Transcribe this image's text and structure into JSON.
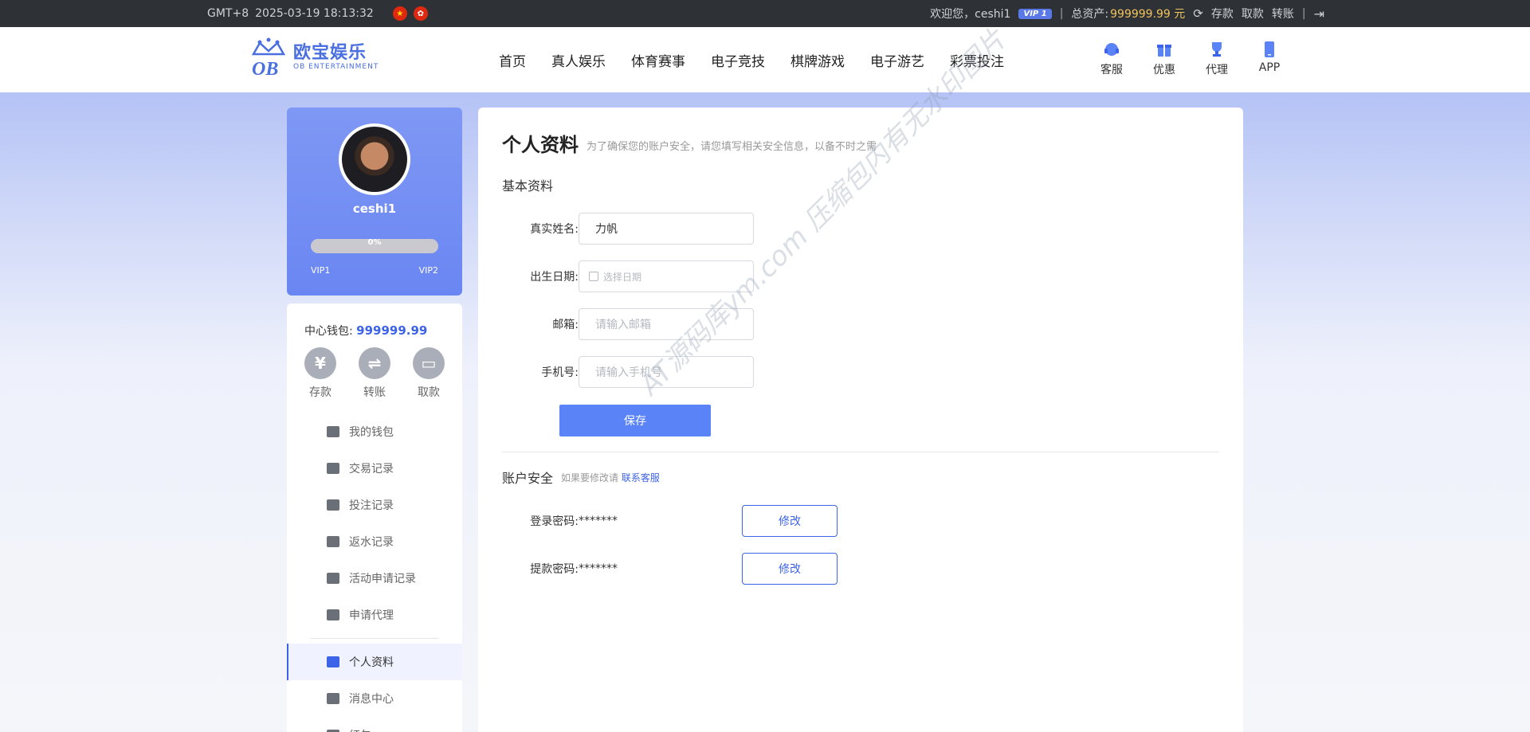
{
  "topbar": {
    "timezone": "GMT+8",
    "datetime": "2025-03-19 18:13:32",
    "welcome": "欢迎您，ceshi1",
    "vip_badge": "VIP 1",
    "assets_label": "总资产:",
    "assets_value": "999999.99 元",
    "deposit": "存款",
    "withdraw": "取款",
    "transfer": "转账"
  },
  "header": {
    "brand": "欧宝娱乐",
    "brand_sub": "OB ENTERTAINMENT",
    "nav": [
      "首页",
      "真人娱乐",
      "体育赛事",
      "电子竞技",
      "棋牌游戏",
      "电子游艺",
      "彩票投注"
    ],
    "quick": [
      {
        "label": "客服",
        "icon": "headset-icon"
      },
      {
        "label": "优惠",
        "icon": "gift-icon"
      },
      {
        "label": "代理",
        "icon": "trophy-icon"
      },
      {
        "label": "APP",
        "icon": "phone-icon"
      }
    ]
  },
  "profile": {
    "username": "ceshi1",
    "progress_percent": 0,
    "progress_text": "0%",
    "vip_current": "VIP1",
    "vip_next": "VIP2"
  },
  "wallet": {
    "label": "中心钱包:",
    "amount": "999999.99",
    "actions": [
      {
        "label": "存款",
        "glyph": "¥"
      },
      {
        "label": "转账",
        "glyph": "⇌"
      },
      {
        "label": "取款",
        "glyph": "▭"
      }
    ]
  },
  "menu": {
    "items": [
      "我的钱包",
      "交易记录",
      "投注记录",
      "返水记录",
      "活动申请记录",
      "申请代理"
    ],
    "items2": [
      "个人资料",
      "消息中心",
      "红包"
    ]
  },
  "main": {
    "title": "个人资料",
    "hint": "为了确保您的账户安全，请您填写相关安全信息，以备不时之需",
    "section_basic": "基本资料",
    "fields": {
      "name_label": "真实姓名:",
      "name_value": "力帆",
      "birth_label": "出生日期:",
      "birth_placeholder": "选择日期",
      "email_label": "邮箱:",
      "email_placeholder": "请输入邮箱",
      "phone_label": "手机号:",
      "phone_placeholder": "请输入手机号"
    },
    "save": "保存",
    "section_security": "账户安全",
    "security_hint": "如果要修改请",
    "security_link": "联系客服",
    "login_pw_label": "登录密码:",
    "login_pw_value": "*******",
    "withdraw_pw_label": "提款密码:",
    "withdraw_pw_value": "*******",
    "modify": "修改"
  },
  "watermark": "AT源码库ym.com 压缩包内有无水印图片",
  "colors": {
    "accent": "#3d63e8",
    "button": "#5a83f8",
    "gold": "#f2c45a",
    "topbar": "#2e3136"
  }
}
